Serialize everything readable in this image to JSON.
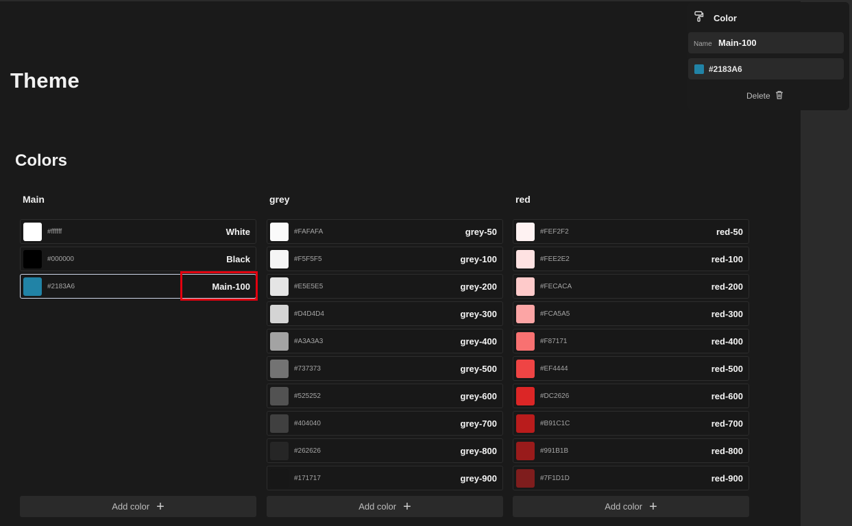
{
  "page": {
    "title": "Theme",
    "section_title": "Colors"
  },
  "groups": [
    {
      "name": "Main",
      "add_label": "Add color",
      "colors": [
        {
          "hex": "#ffffff",
          "name": "White",
          "swatch": "#ffffff"
        },
        {
          "hex": "#000000",
          "name": "Black",
          "swatch": "#000000"
        },
        {
          "hex": "#2183A6",
          "name": "Main-100",
          "swatch": "#2183A6",
          "selected": true
        }
      ]
    },
    {
      "name": "grey",
      "add_label": "Add color",
      "colors": [
        {
          "hex": "#FAFAFA",
          "name": "grey-50",
          "swatch": "#FAFAFA"
        },
        {
          "hex": "#F5F5F5",
          "name": "grey-100",
          "swatch": "#F5F5F5"
        },
        {
          "hex": "#E5E5E5",
          "name": "grey-200",
          "swatch": "#E5E5E5"
        },
        {
          "hex": "#D4D4D4",
          "name": "grey-300",
          "swatch": "#D4D4D4"
        },
        {
          "hex": "#A3A3A3",
          "name": "grey-400",
          "swatch": "#A3A3A3"
        },
        {
          "hex": "#737373",
          "name": "grey-500",
          "swatch": "#737373"
        },
        {
          "hex": "#525252",
          "name": "grey-600",
          "swatch": "#525252"
        },
        {
          "hex": "#404040",
          "name": "grey-700",
          "swatch": "#404040"
        },
        {
          "hex": "#262626",
          "name": "grey-800",
          "swatch": "#262626"
        },
        {
          "hex": "#171717",
          "name": "grey-900",
          "swatch": "#171717"
        }
      ]
    },
    {
      "name": "red",
      "add_label": "Add color",
      "colors": [
        {
          "hex": "#FEF2F2",
          "name": "red-50",
          "swatch": "#FEF2F2"
        },
        {
          "hex": "#FEE2E2",
          "name": "red-100",
          "swatch": "#FEE2E2"
        },
        {
          "hex": "#FECACA",
          "name": "red-200",
          "swatch": "#FECACA"
        },
        {
          "hex": "#FCA5A5",
          "name": "red-300",
          "swatch": "#FCA5A5"
        },
        {
          "hex": "#F87171",
          "name": "red-400",
          "swatch": "#F87171"
        },
        {
          "hex": "#EF4444",
          "name": "red-500",
          "swatch": "#EF4444"
        },
        {
          "hex": "#DC2626",
          "name": "red-600",
          "swatch": "#DC2626"
        },
        {
          "hex": "#B91C1C",
          "name": "red-700",
          "swatch": "#B91C1C"
        },
        {
          "hex": "#991B1B",
          "name": "red-800",
          "swatch": "#991B1B"
        },
        {
          "hex": "#7F1D1D",
          "name": "red-900",
          "swatch": "#7F1D1D"
        }
      ]
    }
  ],
  "panel": {
    "title": "Color",
    "icon": "paint-roller-icon",
    "name_label": "Name",
    "name_value": "Main-100",
    "color_hex": "#2183A6",
    "color_swatch": "#2183A6",
    "delete_label": "Delete",
    "delete_icon": "trash-icon"
  },
  "colors": {
    "background": "#1a1a1a",
    "highlight": "#e3000f",
    "add_plus_icon": "plus-icon"
  }
}
